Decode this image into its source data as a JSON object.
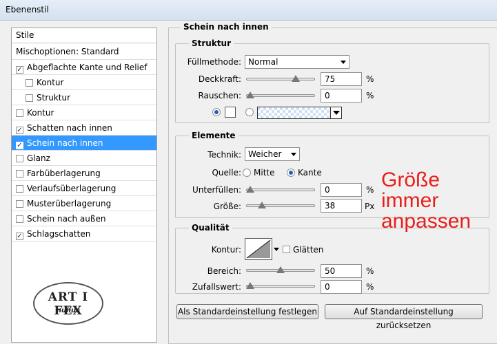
{
  "window": {
    "title": "Ebenenstil"
  },
  "stylelist": {
    "header": "Stile",
    "blending": "Mischoptionen: Standard",
    "items": [
      {
        "label": "Abgeflachte Kante und Relief",
        "checked": true
      },
      {
        "label": "Kontur",
        "checked": false
      },
      {
        "label": "Struktur",
        "checked": false
      },
      {
        "label": "Kontur",
        "checked": false
      },
      {
        "label": "Schatten nach innen",
        "checked": true
      },
      {
        "label": "Schein nach innen",
        "checked": true,
        "selected": true
      },
      {
        "label": "Glanz",
        "checked": false
      },
      {
        "label": "Farbüberlagerung",
        "checked": false
      },
      {
        "label": "Verlaufsüberlagerung",
        "checked": false
      },
      {
        "label": "Musterüberlagerung",
        "checked": false
      },
      {
        "label": "Schein nach außen",
        "checked": false
      },
      {
        "label": "Schlagschatten",
        "checked": true
      }
    ]
  },
  "logo": {
    "text": "ART I FEX",
    "sub": "nulius"
  },
  "panel": {
    "title": "Schein nach innen",
    "struktur": {
      "title": "Struktur",
      "blend_label": "Füllmethode:",
      "blend_value": "Normal",
      "opacity_label": "Deckkraft:",
      "opacity_value": "75",
      "opacity_unit": "%",
      "noise_label": "Rauschen:",
      "noise_value": "0",
      "noise_unit": "%",
      "opacity_level": 0.75,
      "noise_level": 0.0
    },
    "elemente": {
      "title": "Elemente",
      "technique_label": "Technik:",
      "technique_value": "Weicher",
      "source_label": "Quelle:",
      "source_center": "Mitte",
      "source_edge": "Kante",
      "choke_label": "Unterfüllen:",
      "choke_value": "0",
      "choke_unit": "%",
      "size_label": "Größe:",
      "size_value": "38",
      "size_unit": "Px",
      "choke_level": 0.0,
      "size_level": 0.19
    },
    "qualitaet": {
      "title": "Qualität",
      "contour_label": "Kontur:",
      "antialias_label": "Glätten",
      "range_label": "Bereich:",
      "range_value": "50",
      "range_unit": "%",
      "jitter_label": "Zufallswert:",
      "jitter_value": "0",
      "jitter_unit": "%",
      "range_level": 0.5,
      "jitter_level": 0.0
    },
    "buttons": {
      "make_default": "Als Standardeinstellung festlegen",
      "reset_default": "Auf Standardeinstellung zurücksetzen"
    }
  },
  "annotation": {
    "lines": [
      "Größe",
      "immer",
      "anpassen"
    ],
    "color": "#e8201c"
  }
}
